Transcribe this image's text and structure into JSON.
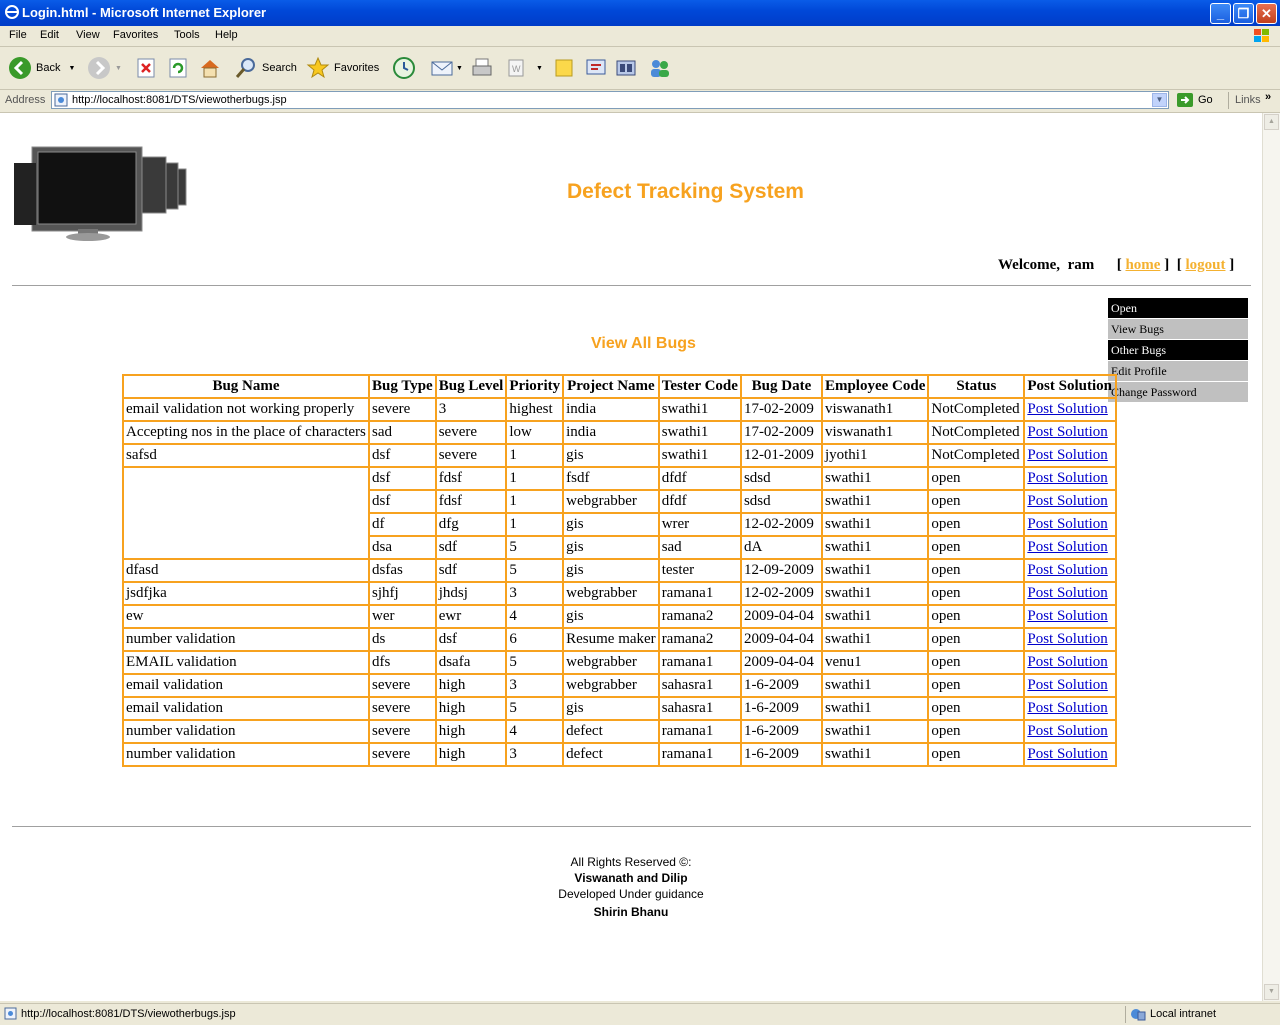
{
  "window": {
    "title": "Login.html - Microsoft Internet Explorer",
    "minimize": "_",
    "maximize": "❐",
    "close": "✕"
  },
  "menubar": [
    "File",
    "Edit",
    "View",
    "Favorites",
    "Tools",
    "Help"
  ],
  "toolbar": {
    "back": "Back",
    "search": "Search",
    "favorites": "Favorites"
  },
  "address": {
    "label": "Address",
    "url": "http://localhost:8081/DTS/viewotherbugs.jsp",
    "go": "Go",
    "links": "Links",
    "chevron": "»"
  },
  "page": {
    "app_title": "Defect Tracking System",
    "welcome": "Welcome,",
    "user": "ram",
    "home_link": "home",
    "logout_link": "logout",
    "section_title": "View All Bugs",
    "menu": [
      "Open",
      "View Bugs",
      "Other Bugs",
      "Edit Profile",
      "Change Password"
    ],
    "table": {
      "headers": [
        "Bug Name",
        "Bug Type",
        "Bug Level",
        "Priority",
        "Project Name",
        "Tester Code",
        "Bug Date",
        "Employee Code",
        "Status",
        "Post Solution"
      ],
      "action_label": "Post Solution",
      "rows": [
        [
          "email validation not working properly",
          "severe",
          "3",
          "highest",
          "india",
          "swathi1",
          "17-02-2009",
          "viswanath1",
          "NotCompleted"
        ],
        [
          "Accepting nos in the place of characters",
          "sad",
          "severe",
          "low",
          "india",
          "swathi1",
          "17-02-2009",
          "viswanath1",
          "NotCompleted"
        ],
        [
          "safsd",
          "dsf",
          "severe",
          "1",
          "gis",
          "swathi1",
          "12-01-2009",
          "jyothi1",
          "NotCompleted"
        ],
        [
          "",
          "dsf",
          "fdsf",
          "1",
          "fsdf",
          "dfdf",
          "sdsd",
          "swathi1",
          "open"
        ],
        [
          "",
          "dsf",
          "fdsf",
          "1",
          "webgrabber",
          "dfdf",
          "sdsd",
          "swathi1",
          "open"
        ],
        [
          "",
          "df",
          "dfg",
          "1",
          "gis",
          "wrer",
          "12-02-2009",
          "swathi1",
          "open"
        ],
        [
          "",
          "dsa",
          "sdf",
          "5",
          "gis",
          "sad",
          "dA",
          "swathi1",
          "open"
        ],
        [
          "dfasd",
          "dsfas",
          "sdf",
          "5",
          "gis",
          "tester",
          "12-09-2009",
          "swathi1",
          "open"
        ],
        [
          "jsdfjka",
          "sjhfj",
          "jhdsj",
          "3",
          "webgrabber",
          "ramana1",
          "12-02-2009",
          "swathi1",
          "open"
        ],
        [
          "ew",
          "wer",
          "ewr",
          "4",
          "gis",
          "ramana2",
          "2009-04-04",
          "swathi1",
          "open"
        ],
        [
          "number validation",
          "ds",
          "dsf",
          "6",
          "Resume maker",
          "ramana2",
          "2009-04-04",
          "swathi1",
          "open"
        ],
        [
          "EMAIL validation",
          "dfs",
          "dsafa",
          "5",
          "webgrabber",
          "ramana1",
          "2009-04-04",
          "venu1",
          "open"
        ],
        [
          "email validation",
          "severe",
          "high",
          "3",
          "webgrabber",
          "sahasra1",
          "1-6-2009",
          "swathi1",
          "open"
        ],
        [
          "email validation",
          "severe",
          "high",
          "5",
          "gis",
          "sahasra1",
          "1-6-2009",
          "swathi1",
          "open"
        ],
        [
          "number validation",
          "severe",
          "high",
          "4",
          "defect",
          "ramana1",
          "1-6-2009",
          "swathi1",
          "open"
        ],
        [
          "number validation",
          "severe",
          "high",
          "3",
          "defect",
          "ramana1",
          "1-6-2009",
          "swathi1",
          "open"
        ]
      ]
    },
    "footer": {
      "rights": "All Rights Reserved ©:",
      "authors": "Viswanath and Dilip",
      "guidance": "Developed Under guidance",
      "guide": "Shirin Bhanu"
    }
  },
  "status": {
    "text": "http://localhost:8081/DTS/viewotherbugs.jsp",
    "zone": "Local intranet"
  },
  "colors": {
    "accent": "#f7a21f",
    "titlebar": "#0054e3",
    "link": "#0000cc"
  }
}
